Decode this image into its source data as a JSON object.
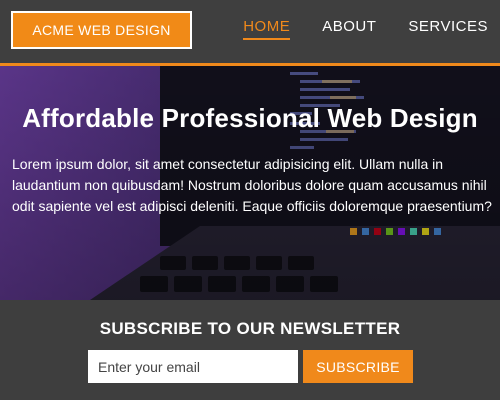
{
  "header": {
    "logo_text": "ACME WEB DESIGN",
    "nav": [
      {
        "label": "HOME",
        "active": true
      },
      {
        "label": "ABOUT",
        "active": false
      },
      {
        "label": "SERVICES",
        "active": false
      }
    ]
  },
  "hero": {
    "title": "Affordable Professional Web Design",
    "text": "Lorem ipsum dolor, sit amet consectetur adipisicing elit. Ullam nulla in laudantium non quibusdam! Nostrum doloribus dolore quam accusamus nihil odit sapiente vel est adipisci deleniti. Eaque officiis doloremque praesentium?"
  },
  "newsletter": {
    "title": "SUBSCRIBE TO OUR NEWSLETTER",
    "email_placeholder": "Enter your email",
    "email_value": "",
    "button_label": "SUBSCRIBE"
  },
  "colors": {
    "accent": "#f0891b",
    "header_bg": "#3f3f3f",
    "newsletter_bg": "#3e3e3e"
  }
}
